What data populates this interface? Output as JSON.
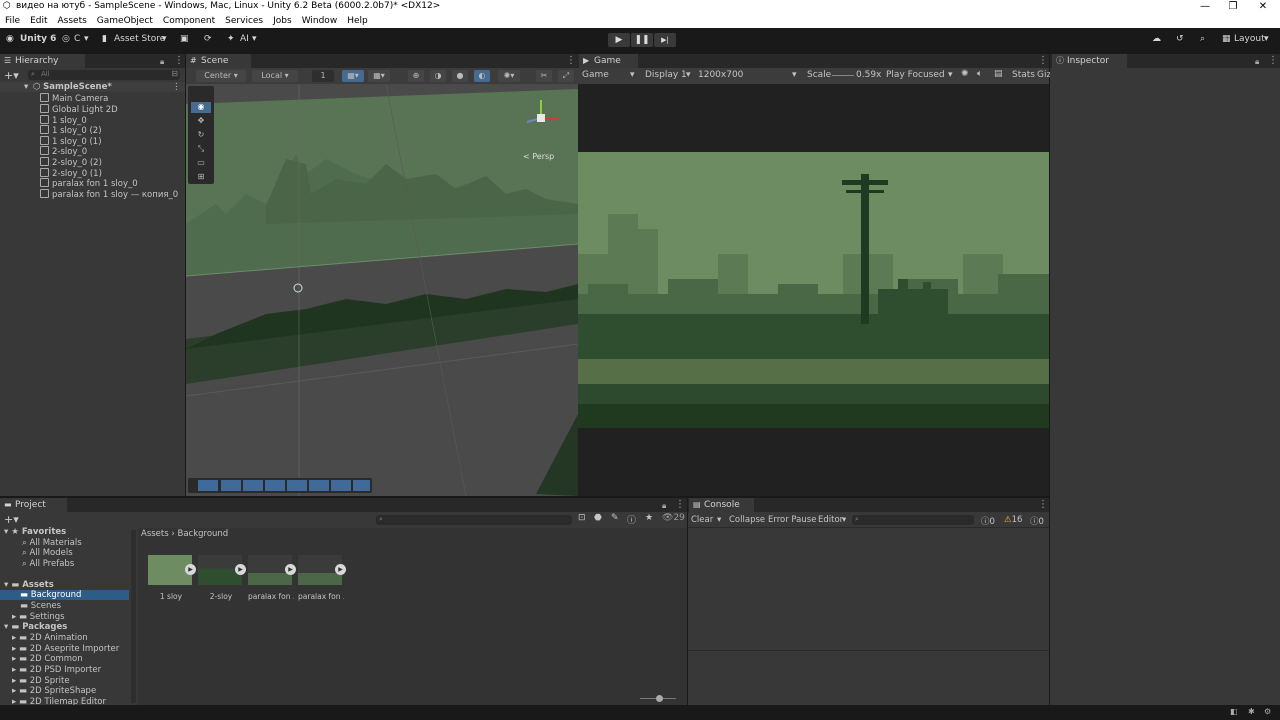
{
  "window": {
    "title": "видео на ютуб - SampleScene - Windows, Mac, Linux - Unity 6.2 Beta (6000.2.0b7)* <DX12>",
    "min": "—",
    "max": "❐",
    "close": "✕"
  },
  "menu": [
    "File",
    "Edit",
    "Assets",
    "GameObject",
    "Component",
    "Services",
    "Jobs",
    "Window",
    "Help"
  ],
  "toolbar": {
    "unity": "Unity 6",
    "account": "C",
    "asset_store": "Asset Store",
    "ai": "AI",
    "layout": "Layout",
    "play": "▶",
    "pause": "❚❚",
    "step": "▶|"
  },
  "hierarchy": {
    "tab": "Hierarchy",
    "search_placeholder": "All",
    "scene": "SampleScene*",
    "items": [
      "Main Camera",
      "Global Light 2D",
      "1 sloy_0",
      "1 sloy_0 (2)",
      "1 sloy_0 (1)",
      "2-sloy_0",
      "2-sloy_0 (2)",
      "2-sloy_0 (1)",
      "paralax fon 1 sloy_0",
      "paralax fon 1 sloy — копия_0"
    ]
  },
  "scene": {
    "tab": "Scene",
    "pivot": "Center",
    "space": "Local",
    "snap": "1",
    "persp": "< Persp"
  },
  "game": {
    "tab": "Game",
    "mode": "Game",
    "display": "Display 1",
    "resolution": "1200x700",
    "scale_label": "Scale",
    "scale": "0.59x",
    "play_focused": "Play Focused",
    "stats": "Stats",
    "gizmos": "Giz"
  },
  "inspector": {
    "tab": "Inspector"
  },
  "project": {
    "tab": "Project",
    "favorites": {
      "label": "Favorites",
      "items": [
        "All Materials",
        "All Models",
        "All Prefabs"
      ]
    },
    "assets": {
      "label": "Assets",
      "items": [
        "Background",
        "Scenes",
        "Settings"
      ]
    },
    "packages": {
      "label": "Packages",
      "items": [
        "2D Animation",
        "2D Aseprite Importer",
        "2D Common",
        "2D PSD Importer",
        "2D Sprite",
        "2D SpriteShape",
        "2D Tilemap Editor"
      ]
    },
    "breadcrumb": [
      "Assets",
      "Background"
    ],
    "hidden_count": "29",
    "files": [
      "1 sloy",
      "2-sloy",
      "paralax fon ...",
      "paralax fon ..."
    ]
  },
  "console": {
    "tab": "Console",
    "clear": "Clear",
    "collapse": "Collapse",
    "error_pause": "Error Pause",
    "editor": "Editor",
    "info_count": "0",
    "warn_count": "16",
    "error_count": "0"
  },
  "colors": {
    "bg": "#191919",
    "panel": "#383838",
    "accent": "#2c5d87",
    "game_green_light": "#6d8c62",
    "game_green_dark": "#1f3a1f"
  }
}
